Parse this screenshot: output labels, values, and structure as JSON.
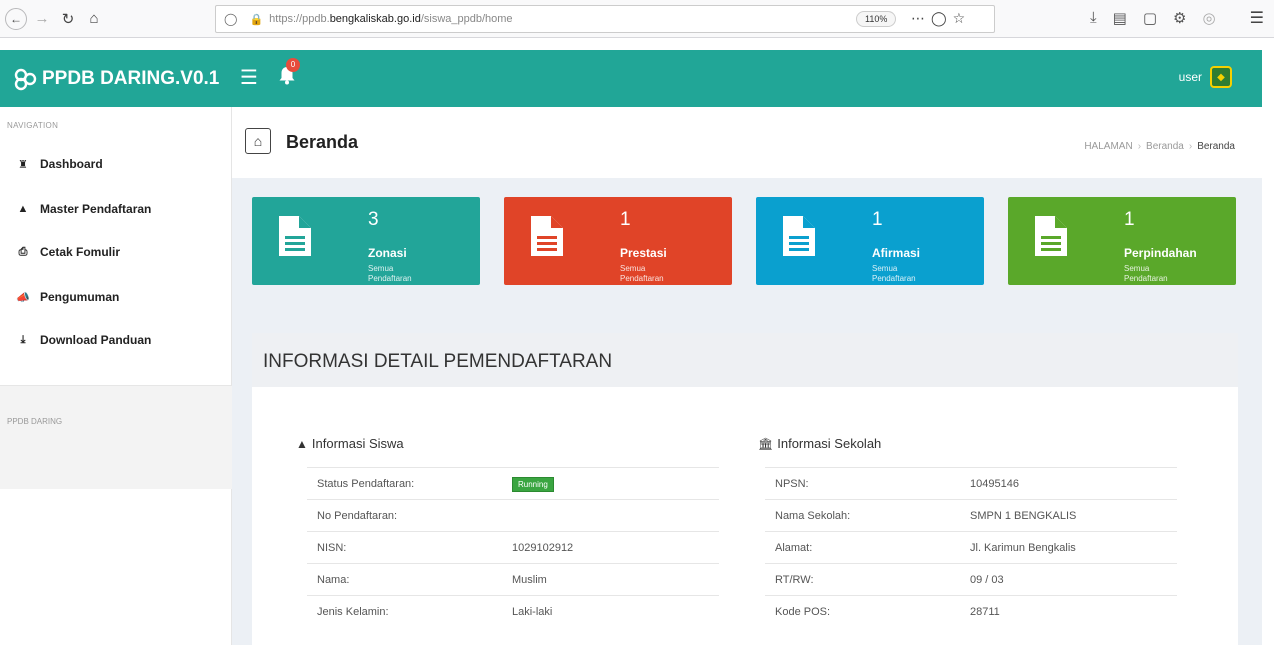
{
  "browser": {
    "url_prefix": "https://ppdb.",
    "url_domain": "bengkaliskab.go.id",
    "url_path": "/siswa_ppdb/home",
    "zoom": "110%"
  },
  "header": {
    "brand": "PPDB DARING.V0.1",
    "notification_count": "0",
    "user_label": "user",
    "accent_color": "#21a697"
  },
  "sidebar": {
    "heading": "NAVIGATION",
    "items": [
      {
        "label": "Dashboard",
        "icon": "home-icon"
      },
      {
        "label": "Master Pendaftaran",
        "icon": "user-icon"
      },
      {
        "label": "Cetak Fomulir",
        "icon": "print-icon"
      },
      {
        "label": "Pengumuman",
        "icon": "bullhorn-icon"
      },
      {
        "label": "Download Panduan",
        "icon": "download-icon"
      }
    ],
    "footer": "PPDB DARING"
  },
  "page": {
    "title": "Beranda",
    "breadcrumb": [
      "HALAMAN",
      "Beranda",
      "Beranda"
    ]
  },
  "tiles": [
    {
      "count": "3",
      "label": "Zonasi",
      "sub": "Semua Pendaftaran",
      "color": "#22a599"
    },
    {
      "count": "1",
      "label": "Prestasi",
      "sub": "Semua Pendaftaran",
      "color": "#e04428"
    },
    {
      "count": "1",
      "label": "Afirmasi",
      "sub": "Semua Pendaftaran",
      "color": "#0aa0cf"
    },
    {
      "count": "1",
      "label": "Perpindahan",
      "sub": "Semua Pendaftaran",
      "color": "#5aa82a"
    }
  ],
  "panel": {
    "title": "INFORMASI DETAIL PEMENDAFTARAN",
    "siswa": {
      "title": "Informasi Siswa",
      "rows": [
        {
          "k": "Status Pendaftaran:",
          "v": "Running"
        },
        {
          "k": "No Pendaftaran:",
          "v": ""
        },
        {
          "k": "NISN:",
          "v": "1029102912"
        },
        {
          "k": "Nama:",
          "v": "Muslim"
        },
        {
          "k": "Jenis Kelamin:",
          "v": "Laki-laki"
        }
      ]
    },
    "sekolah": {
      "title": "Informasi Sekolah",
      "rows": [
        {
          "k": "NPSN:",
          "v": "10495146"
        },
        {
          "k": "Nama Sekolah:",
          "v": "SMPN 1 BENGKALIS"
        },
        {
          "k": "Alamat:",
          "v": "Jl. Karimun Bengkalis"
        },
        {
          "k": "RT/RW:",
          "v": "09 / 03"
        },
        {
          "k": "Kode POS:",
          "v": "28711"
        }
      ]
    }
  }
}
